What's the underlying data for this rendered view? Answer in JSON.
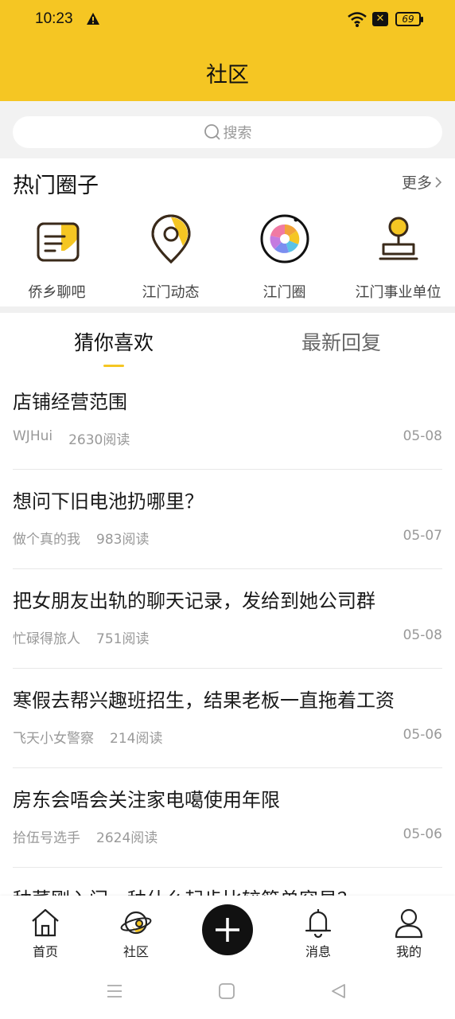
{
  "status_bar": {
    "time": "10:23",
    "battery": "69",
    "sim": "✕"
  },
  "header": {
    "title": "社区"
  },
  "search": {
    "placeholder": "搜索"
  },
  "hot_circles": {
    "title": "热门圈子",
    "more": "更多",
    "items": [
      {
        "label": "侨乡聊吧",
        "icon": "chat-bubble-icon"
      },
      {
        "label": "江门动态",
        "icon": "location-pin-icon"
      },
      {
        "label": "江门圈",
        "icon": "aperture-icon"
      },
      {
        "label": "江门事业单位",
        "icon": "stamp-icon"
      }
    ]
  },
  "tabs": [
    {
      "label": "猜你喜欢",
      "active": true
    },
    {
      "label": "最新回复",
      "active": false
    }
  ],
  "posts": [
    {
      "title": "店铺经营范围",
      "author": "WJHui",
      "reads": "2630阅读",
      "date": "05-08"
    },
    {
      "title": "想问下旧电池扔哪里？",
      "author": "做个真的我",
      "reads": "983阅读",
      "date": "05-07"
    },
    {
      "title": "把女朋友出轨的聊天记录，发给到她公司群",
      "author": "忙碌得旅人",
      "reads": "751阅读",
      "date": "05-08"
    },
    {
      "title": "寒假去帮兴趣班招生，结果老板一直拖着工资",
      "author": "飞天小女警察",
      "reads": "214阅读",
      "date": "05-06"
    },
    {
      "title": "房东会唔会关注家电噶使用年限",
      "author": "拾伍号选手",
      "reads": "2624阅读",
      "date": "05-06"
    },
    {
      "title": "种菜刚入门，种什么起步比较简单容易？",
      "author": "",
      "reads": "",
      "date": ""
    }
  ],
  "bottom_nav": {
    "items": [
      {
        "label": "首页",
        "icon": "home-icon"
      },
      {
        "label": "社区",
        "icon": "community-planet-icon"
      },
      {
        "label": "",
        "icon": "plus-icon"
      },
      {
        "label": "消息",
        "icon": "bell-icon"
      },
      {
        "label": "我的",
        "icon": "person-icon"
      }
    ]
  },
  "colors": {
    "accent": "#f5c623",
    "text": "#1a1a1a",
    "muted": "#999999"
  }
}
